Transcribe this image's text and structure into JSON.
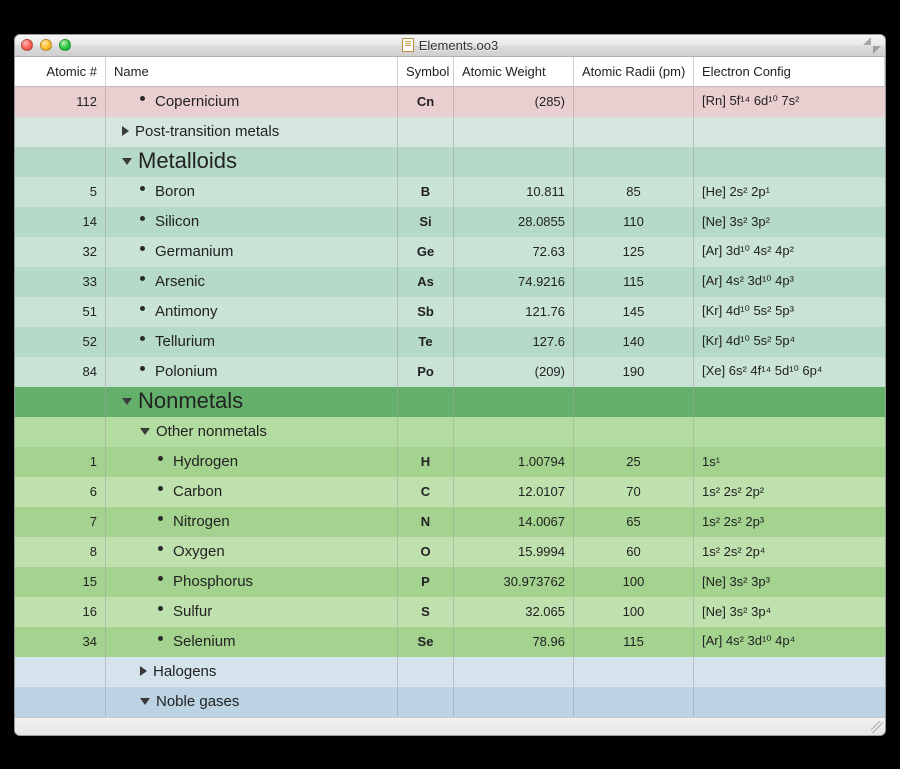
{
  "window": {
    "title": "Elements.oo3"
  },
  "columns": [
    "Atomic #",
    "Name",
    "Symbol",
    "Atomic Weight",
    "Atomic Radii (pm)",
    "Electron Config"
  ],
  "rows": [
    {
      "kind": "leaf",
      "indent": 2,
      "bg": "pink",
      "atomic": "112",
      "name": "Copernicium",
      "symbol": "Cn",
      "weight": "(285)",
      "radii": "",
      "econf": "[Rn] 5f¹⁴ 6d¹⁰ 7s²"
    },
    {
      "kind": "sub",
      "indent": 1,
      "bg": "teal0",
      "disc": "right",
      "name": "Post-transition metals"
    },
    {
      "kind": "grp",
      "indent": 1,
      "bg": "teal1",
      "disc": "down",
      "name": "Metalloids"
    },
    {
      "kind": "leaf",
      "indent": 2,
      "bg": "teal2",
      "atomic": "5",
      "name": "Boron",
      "symbol": "B",
      "weight": "10.811",
      "radii": "85",
      "econf": "[He] 2s² 2p¹"
    },
    {
      "kind": "leaf",
      "indent": 2,
      "bg": "teal1",
      "atomic": "14",
      "name": "Silicon",
      "symbol": "Si",
      "weight": "28.0855",
      "radii": "110",
      "econf": "[Ne] 3s² 3p²"
    },
    {
      "kind": "leaf",
      "indent": 2,
      "bg": "teal2",
      "atomic": "32",
      "name": "Germanium",
      "symbol": "Ge",
      "weight": "72.63",
      "radii": "125",
      "econf": "[Ar] 3d¹⁰ 4s² 4p²"
    },
    {
      "kind": "leaf",
      "indent": 2,
      "bg": "teal1",
      "atomic": "33",
      "name": "Arsenic",
      "symbol": "As",
      "weight": "74.9216",
      "radii": "115",
      "econf": "[Ar] 4s² 3d¹⁰ 4p³"
    },
    {
      "kind": "leaf",
      "indent": 2,
      "bg": "teal2",
      "atomic": "51",
      "name": "Antimony",
      "symbol": "Sb",
      "weight": "121.76",
      "radii": "145",
      "econf": "[Kr] 4d¹⁰ 5s² 5p³"
    },
    {
      "kind": "leaf",
      "indent": 2,
      "bg": "teal1",
      "atomic": "52",
      "name": "Tellurium",
      "symbol": "Te",
      "weight": "127.6",
      "radii": "140",
      "econf": "[Kr] 4d¹⁰ 5s² 5p⁴"
    },
    {
      "kind": "leaf",
      "indent": 2,
      "bg": "teal2",
      "atomic": "84",
      "name": "Polonium",
      "symbol": "Po",
      "weight": "(209)",
      "radii": "190",
      "econf": "[Xe] 6s² 4f¹⁴ 5d¹⁰ 6p⁴"
    },
    {
      "kind": "grp",
      "indent": 1,
      "bg": "green0",
      "disc": "down",
      "name": "Nonmetals"
    },
    {
      "kind": "sub",
      "indent": 2,
      "bg": "green1",
      "disc": "down",
      "name": "Other nonmetals"
    },
    {
      "kind": "leaf",
      "indent": 3,
      "bg": "green2",
      "atomic": "1",
      "name": "Hydrogen",
      "symbol": "H",
      "weight": "1.00794",
      "radii": "25",
      "econf": "1s¹"
    },
    {
      "kind": "leaf",
      "indent": 3,
      "bg": "green3",
      "atomic": "6",
      "name": "Carbon",
      "symbol": "C",
      "weight": "12.0107",
      "radii": "70",
      "econf": "1s² 2s² 2p²"
    },
    {
      "kind": "leaf",
      "indent": 3,
      "bg": "green2",
      "atomic": "7",
      "name": "Nitrogen",
      "symbol": "N",
      "weight": "14.0067",
      "radii": "65",
      "econf": "1s² 2s² 2p³"
    },
    {
      "kind": "leaf",
      "indent": 3,
      "bg": "green3",
      "atomic": "8",
      "name": "Oxygen",
      "symbol": "O",
      "weight": "15.9994",
      "radii": "60",
      "econf": "1s² 2s² 2p⁴"
    },
    {
      "kind": "leaf",
      "indent": 3,
      "bg": "green2",
      "atomic": "15",
      "name": "Phosphorus",
      "symbol": "P",
      "weight": "30.973762",
      "radii": "100",
      "econf": "[Ne] 3s² 3p³"
    },
    {
      "kind": "leaf",
      "indent": 3,
      "bg": "green3",
      "atomic": "16",
      "name": "Sulfur",
      "symbol": "S",
      "weight": "32.065",
      "radii": "100",
      "econf": "[Ne] 3s² 3p⁴"
    },
    {
      "kind": "leaf",
      "indent": 3,
      "bg": "green2",
      "atomic": "34",
      "name": "Selenium",
      "symbol": "Se",
      "weight": "78.96",
      "radii": "115",
      "econf": "[Ar] 4s² 3d¹⁰ 4p⁴"
    },
    {
      "kind": "sub",
      "indent": 2,
      "bg": "blue0",
      "disc": "right",
      "name": "Halogens"
    },
    {
      "kind": "sub",
      "indent": 2,
      "bg": "blue1",
      "disc": "down",
      "name": "Noble gases"
    }
  ]
}
